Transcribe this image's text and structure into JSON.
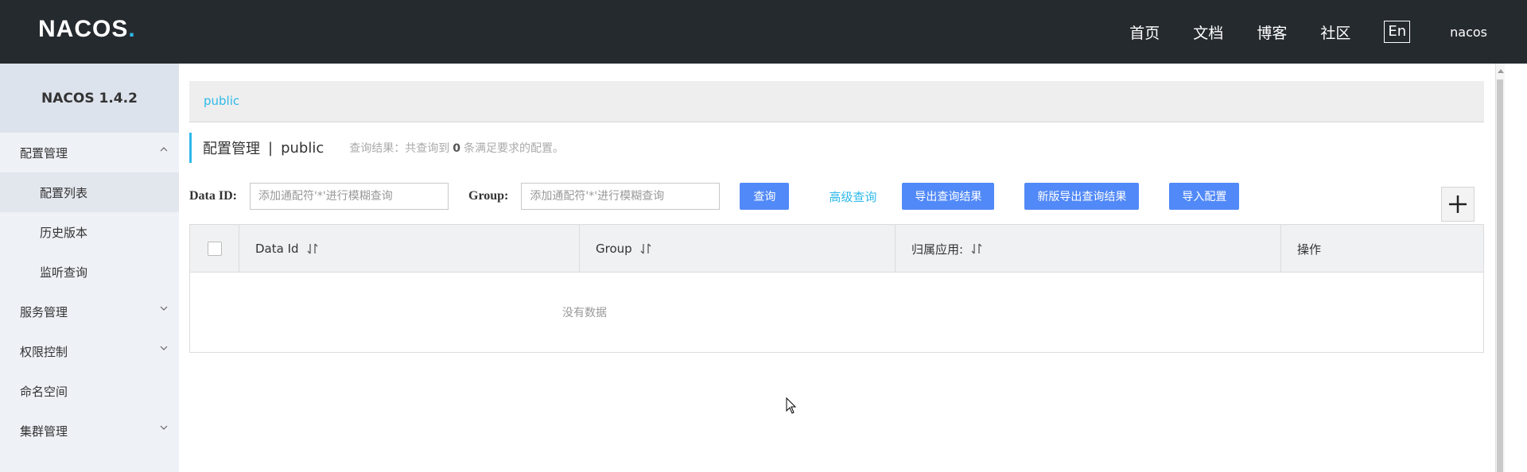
{
  "header": {
    "logo_main": "NACOS",
    "logo_dot": ".",
    "nav": [
      "首页",
      "文档",
      "博客",
      "社区"
    ],
    "lang": "En",
    "user": "nacos"
  },
  "sidebar": {
    "version": "NACOS 1.4.2",
    "items": [
      {
        "label": "配置管理"
      },
      {
        "label": "配置列表"
      },
      {
        "label": "历史版本"
      },
      {
        "label": "监听查询"
      },
      {
        "label": "服务管理"
      },
      {
        "label": "权限控制"
      },
      {
        "label": "命名空间"
      },
      {
        "label": "集群管理"
      }
    ]
  },
  "breadcrumb": {
    "namespace": "public"
  },
  "title": {
    "main": "配置管理",
    "separator": "|",
    "namespace": "public",
    "result_prefix": "查询结果：共查询到",
    "result_count": "0",
    "result_suffix": "条满足要求的配置。"
  },
  "search": {
    "dataid_label": "Data ID:",
    "dataid_placeholder": "添加通配符'*'进行模糊查询",
    "group_label": "Group:",
    "group_placeholder": "添加通配符'*'进行模糊查询",
    "query_btn": "查询",
    "advanced_link": "高级查询",
    "export_btn": "导出查询结果",
    "export_new_btn": "新版导出查询结果",
    "import_btn": "导入配置"
  },
  "table": {
    "columns": [
      "Data Id",
      "Group",
      "归属应用:",
      "操作"
    ],
    "empty_text": "没有数据"
  },
  "colors": {
    "header_bg": "#252a2f",
    "accent": "#2fb9ea",
    "button": "#5189f8",
    "sidebar_bg": "#eef1f6"
  }
}
